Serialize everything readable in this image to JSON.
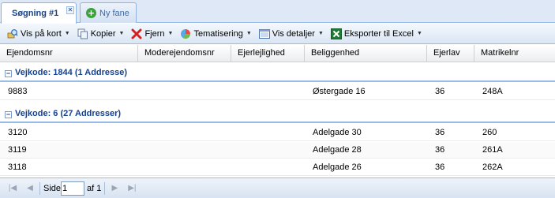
{
  "tabs": [
    {
      "label": "Søgning #1",
      "active": true
    },
    {
      "label": "Ny fane",
      "active": false
    }
  ],
  "toolbar": {
    "vis_paa_kort": "Vis på kort",
    "kopier": "Kopier",
    "fjern": "Fjern",
    "tematisering": "Tematisering",
    "vis_detaljer": "Vis detaljer",
    "eksporter": "Eksporter til Excel"
  },
  "columns": [
    "Ejendomsnr",
    "Moderejendomsnr",
    "Ejerlejlighed",
    "Beliggenhed",
    "Ejerlav",
    "Matrikelnr"
  ],
  "groups": [
    {
      "title": "Vejkode: 1844 (1 Addresse)",
      "rows": [
        {
          "ejendomsnr": "9883",
          "moderejendomsnr": "",
          "ejerlejlighed": "",
          "beliggenhed": "Østergade 16",
          "ejerlav": "36",
          "matrikelnr": "248A"
        }
      ]
    },
    {
      "title": "Vejkode: 6 (27 Addresser)",
      "rows": [
        {
          "ejendomsnr": "3120",
          "moderejendomsnr": "",
          "ejerlejlighed": "",
          "beliggenhed": "Adelgade 30",
          "ejerlav": "36",
          "matrikelnr": "260"
        },
        {
          "ejendomsnr": "3119",
          "moderejendomsnr": "",
          "ejerlejlighed": "",
          "beliggenhed": "Adelgade 28",
          "ejerlav": "36",
          "matrikelnr": "261A"
        },
        {
          "ejendomsnr": "3118",
          "moderejendomsnr": "",
          "ejerlejlighed": "",
          "beliggenhed": "Adelgade 26",
          "ejerlav": "36",
          "matrikelnr": "262A"
        }
      ]
    }
  ],
  "pager": {
    "side_label": "Side",
    "page_value": "1",
    "af_label": "af 1"
  },
  "colors": {
    "accent": "#15428b",
    "border": "#99bbe8"
  }
}
